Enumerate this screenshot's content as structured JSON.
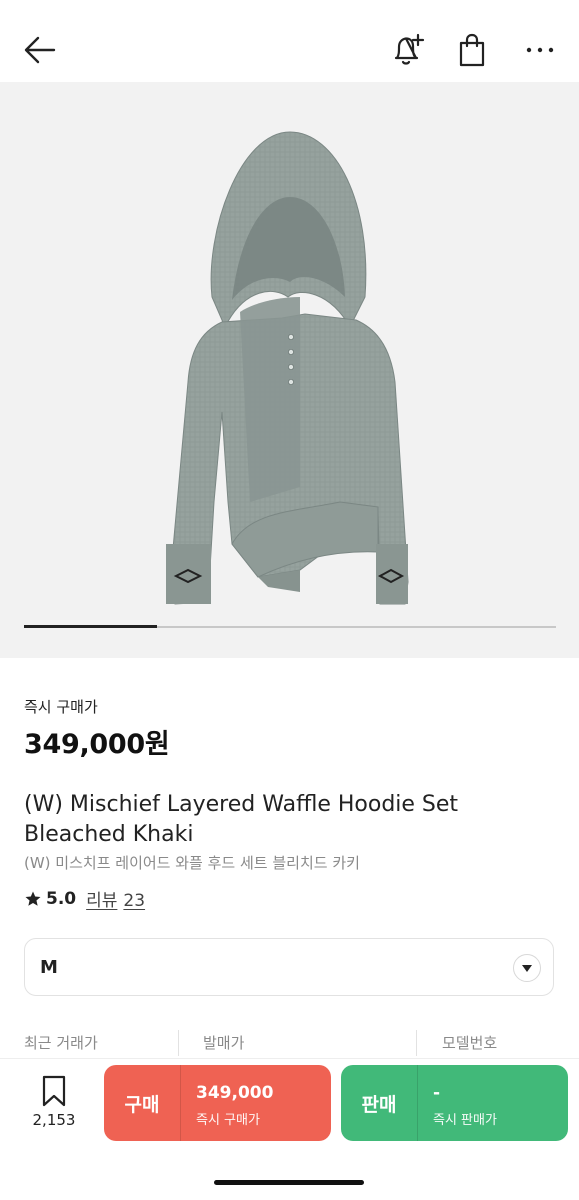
{
  "header": {
    "back_icon": "arrow-left-icon",
    "alert_icon": "bell-plus-icon",
    "bag_icon": "shopping-bag-icon",
    "more_icon": "more-horizontal-icon"
  },
  "gallery": {
    "image_alt": "Gray waffle hoodie with asymmetric hem",
    "current_index": 1,
    "total": 4,
    "progress_fraction": 0.25
  },
  "price": {
    "label": "즉시 구매가",
    "value": "349,000원"
  },
  "product": {
    "title_en": "(W) Mischief Layered Waffle Hoodie Set Bleached Khaki",
    "title_ko": "(W) 미스치프 레이어드 와플 후드 세트 블리치드 카키",
    "rating": "5.0",
    "review_label": "리뷰",
    "review_count": "23"
  },
  "size_select": {
    "value": "M",
    "icon": "caret-down-icon"
  },
  "info_row": {
    "col1": "최근 거래가",
    "col2": "발매가",
    "col3": "모델번호"
  },
  "bottom_bar": {
    "wish_icon": "bookmark-icon",
    "wish_count": "2,153",
    "buy": {
      "label": "구매",
      "price": "349,000",
      "sub": "즉시 구매가",
      "color": "#ef6253"
    },
    "sell": {
      "label": "판매",
      "price": "-",
      "sub": "즉시 판매가",
      "color": "#41b979"
    }
  }
}
